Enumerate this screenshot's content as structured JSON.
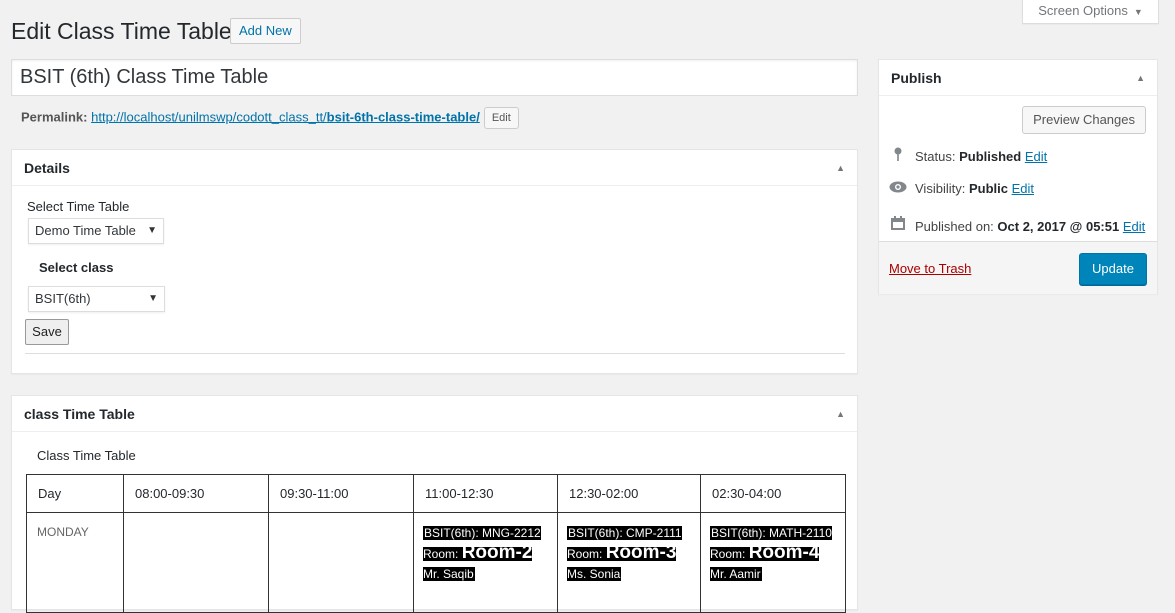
{
  "screen_options": {
    "label": "Screen Options"
  },
  "header": {
    "title": "Edit Class Time Table",
    "add_new": "Add New"
  },
  "post": {
    "title_value": "BSIT (6th) Class Time Table",
    "permalink_label": "Permalink:",
    "permalink_base": "http://localhost/unilmswp/codott_class_tt/",
    "permalink_slug": "bsit-6th-class-time-table/",
    "permalink_edit": "Edit"
  },
  "details": {
    "heading": "Details",
    "select_tt_label": "Select Time Table",
    "select_tt_value": "Demo Time Table",
    "select_class_label": "Select class",
    "select_class_value": "BSIT(6th)",
    "save": "Save"
  },
  "timetable": {
    "heading": "class Time Table",
    "caption": "Class Time Table",
    "columns": [
      "Day",
      "08:00-09:30",
      "09:30-11:00",
      "11:00-12:30",
      "12:30-02:00",
      "02:30-04:00"
    ],
    "rows": [
      {
        "day": "MONDAY",
        "slots": [
          {
            "empty": true
          },
          {
            "empty": true
          },
          {
            "course": "BSIT(6th): MNG-2212",
            "room_label": "Room:",
            "room": "Room-2",
            "teacher": "Mr. Saqib"
          },
          {
            "course": "BSIT(6th): CMP-2111",
            "room_label": "Room:",
            "room": "Room-3",
            "teacher": "Ms. Sonia"
          },
          {
            "course": "BSIT(6th): MATH-2110",
            "room_label": "Room:",
            "room": "Room-4",
            "teacher": "Mr. Aamir"
          }
        ]
      }
    ]
  },
  "publish": {
    "heading": "Publish",
    "preview": "Preview Changes",
    "status_label": "Status:",
    "status_value": "Published",
    "visibility_label": "Visibility:",
    "visibility_value": "Public",
    "published_label": "Published on:",
    "published_value": "Oct 2, 2017 @ 05:51",
    "edit": "Edit",
    "trash": "Move to Trash",
    "update": "Update"
  },
  "icons": {
    "pin": "pin-icon",
    "eye": "eye-icon",
    "calendar": "calendar-icon",
    "arrow_up": "triangle-up-icon"
  },
  "colors": {
    "primary": "#0085ba",
    "link": "#0073aa",
    "trash": "#a00"
  }
}
